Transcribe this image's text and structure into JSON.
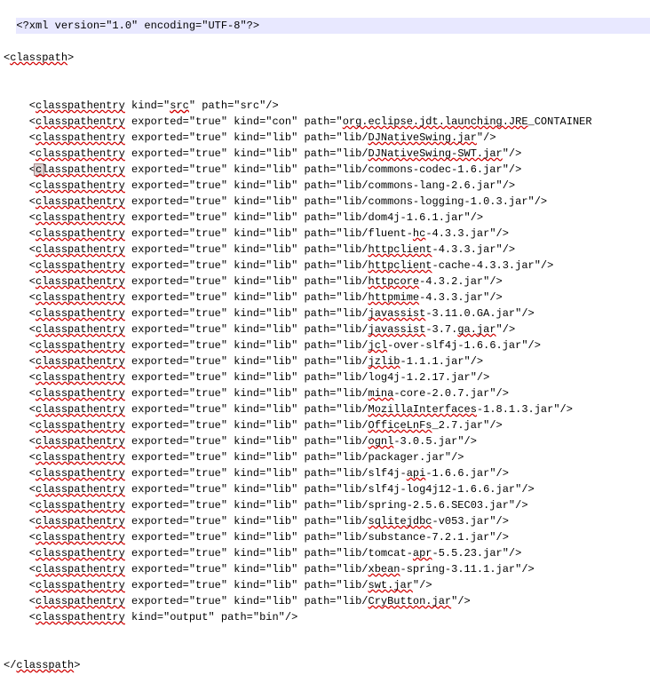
{
  "xml_decl": "<?xml version=\"1.0\" encoding=\"UTF-8\"?>",
  "root_open": "<classpath>",
  "root_close": "</classpath>",
  "entries": [
    {
      "raw": "<classpathentry kind=\"src\" path=\"src\"/>",
      "err": [
        "classpathentry",
        "src",
        "src"
      ]
    },
    {
      "raw": "<classpathentry exported=\"true\" kind=\"con\" path=\"org.eclipse.jdt.launching.JRE_CONTAINER",
      "err": [
        "classpathentry",
        "org.eclipse.jdt.launching.JRE"
      ]
    },
    {
      "raw": "<classpathentry exported=\"true\" kind=\"lib\" path=\"lib/DJNativeSwing.jar\"/>",
      "err": [
        "classpathentry",
        "DJNativeSwing.jar"
      ]
    },
    {
      "raw": "<classpathentry exported=\"true\" kind=\"lib\" path=\"lib/DJNativeSwing-SWT.jar\"/>",
      "err": [
        "classpathentry",
        "DJNativeSwing-SWT.jar"
      ]
    },
    {
      "raw": "<classpathentry exported=\"true\" kind=\"lib\" path=\"lib/commons-codec-1.6.jar\"/>",
      "err": [
        "classpathentry"
      ],
      "caret": true
    },
    {
      "raw": "<classpathentry exported=\"true\" kind=\"lib\" path=\"lib/commons-lang-2.6.jar\"/>",
      "err": [
        "classpathentry"
      ]
    },
    {
      "raw": "<classpathentry exported=\"true\" kind=\"lib\" path=\"lib/commons-logging-1.0.3.jar\"/>",
      "err": [
        "classpathentry"
      ]
    },
    {
      "raw": "<classpathentry exported=\"true\" kind=\"lib\" path=\"lib/dom4j-1.6.1.jar\"/>",
      "err": [
        "classpathentry"
      ]
    },
    {
      "raw": "<classpathentry exported=\"true\" kind=\"lib\" path=\"lib/fluent-hc-4.3.3.jar\"/>",
      "err": [
        "classpathentry",
        "hc"
      ]
    },
    {
      "raw": "<classpathentry exported=\"true\" kind=\"lib\" path=\"lib/httpclient-4.3.3.jar\"/>",
      "err": [
        "classpathentry",
        "httpclient"
      ]
    },
    {
      "raw": "<classpathentry exported=\"true\" kind=\"lib\" path=\"lib/httpclient-cache-4.3.3.jar\"/>",
      "err": [
        "classpathentry",
        "httpclient"
      ]
    },
    {
      "raw": "<classpathentry exported=\"true\" kind=\"lib\" path=\"lib/httpcore-4.3.2.jar\"/>",
      "err": [
        "classpathentry",
        "httpcore"
      ]
    },
    {
      "raw": "<classpathentry exported=\"true\" kind=\"lib\" path=\"lib/httpmime-4.3.3.jar\"/>",
      "err": [
        "classpathentry",
        "httpmime"
      ]
    },
    {
      "raw": "<classpathentry exported=\"true\" kind=\"lib\" path=\"lib/javassist-3.11.0.GA.jar\"/>",
      "err": [
        "classpathentry",
        "javassist"
      ]
    },
    {
      "raw": "<classpathentry exported=\"true\" kind=\"lib\" path=\"lib/javassist-3.7.ga.jar\"/>",
      "err": [
        "classpathentry",
        "javassist",
        "ga.jar"
      ]
    },
    {
      "raw": "<classpathentry exported=\"true\" kind=\"lib\" path=\"lib/jcl-over-slf4j-1.6.6.jar\"/>",
      "err": [
        "classpathentry",
        "jcl"
      ]
    },
    {
      "raw": "<classpathentry exported=\"true\" kind=\"lib\" path=\"lib/jzlib-1.1.1.jar\"/>",
      "err": [
        "classpathentry",
        "jzlib"
      ]
    },
    {
      "raw": "<classpathentry exported=\"true\" kind=\"lib\" path=\"lib/log4j-1.2.17.jar\"/>",
      "err": [
        "classpathentry"
      ]
    },
    {
      "raw": "<classpathentry exported=\"true\" kind=\"lib\" path=\"lib/mina-core-2.0.7.jar\"/>",
      "err": [
        "classpathentry",
        "mina"
      ]
    },
    {
      "raw": "<classpathentry exported=\"true\" kind=\"lib\" path=\"lib/MozillaInterfaces-1.8.1.3.jar\"/>",
      "err": [
        "classpathentry",
        "MozillaInterfaces"
      ]
    },
    {
      "raw": "<classpathentry exported=\"true\" kind=\"lib\" path=\"lib/OfficeLnFs_2.7.jar\"/>",
      "err": [
        "classpathentry",
        "OfficeLnFs"
      ]
    },
    {
      "raw": "<classpathentry exported=\"true\" kind=\"lib\" path=\"lib/ognl-3.0.5.jar\"/>",
      "err": [
        "classpathentry",
        "ognl"
      ]
    },
    {
      "raw": "<classpathentry exported=\"true\" kind=\"lib\" path=\"lib/packager.jar\"/>",
      "err": [
        "classpathentry"
      ]
    },
    {
      "raw": "<classpathentry exported=\"true\" kind=\"lib\" path=\"lib/slf4j-api-1.6.6.jar\"/>",
      "err": [
        "classpathentry",
        "api"
      ]
    },
    {
      "raw": "<classpathentry exported=\"true\" kind=\"lib\" path=\"lib/slf4j-log4j12-1.6.6.jar\"/>",
      "err": [
        "classpathentry"
      ]
    },
    {
      "raw": "<classpathentry exported=\"true\" kind=\"lib\" path=\"lib/spring-2.5.6.SEC03.jar\"/>",
      "err": [
        "classpathentry"
      ]
    },
    {
      "raw": "<classpathentry exported=\"true\" kind=\"lib\" path=\"lib/sqlitejdbc-v053.jar\"/>",
      "err": [
        "classpathentry",
        "sqlitejdbc"
      ]
    },
    {
      "raw": "<classpathentry exported=\"true\" kind=\"lib\" path=\"lib/substance-7.2.1.jar\"/>",
      "err": [
        "classpathentry"
      ]
    },
    {
      "raw": "<classpathentry exported=\"true\" kind=\"lib\" path=\"lib/tomcat-apr-5.5.23.jar\"/>",
      "err": [
        "classpathentry",
        "apr"
      ]
    },
    {
      "raw": "<classpathentry exported=\"true\" kind=\"lib\" path=\"lib/xbean-spring-3.11.1.jar\"/>",
      "err": [
        "classpathentry",
        "xbean"
      ]
    },
    {
      "raw": "<classpathentry exported=\"true\" kind=\"lib\" path=\"lib/swt.jar\"/>",
      "err": [
        "classpathentry",
        "swt.jar"
      ]
    },
    {
      "raw": "<classpathentry exported=\"true\" kind=\"lib\" path=\"lib/CryButton.jar\"/>",
      "err": [
        "classpathentry",
        "CryButton.jar"
      ]
    },
    {
      "raw": "<classpathentry kind=\"output\" path=\"bin\"/>",
      "err": [
        "classpathentry"
      ]
    }
  ],
  "indent": "    ",
  "root_err": [
    "classpath"
  ]
}
